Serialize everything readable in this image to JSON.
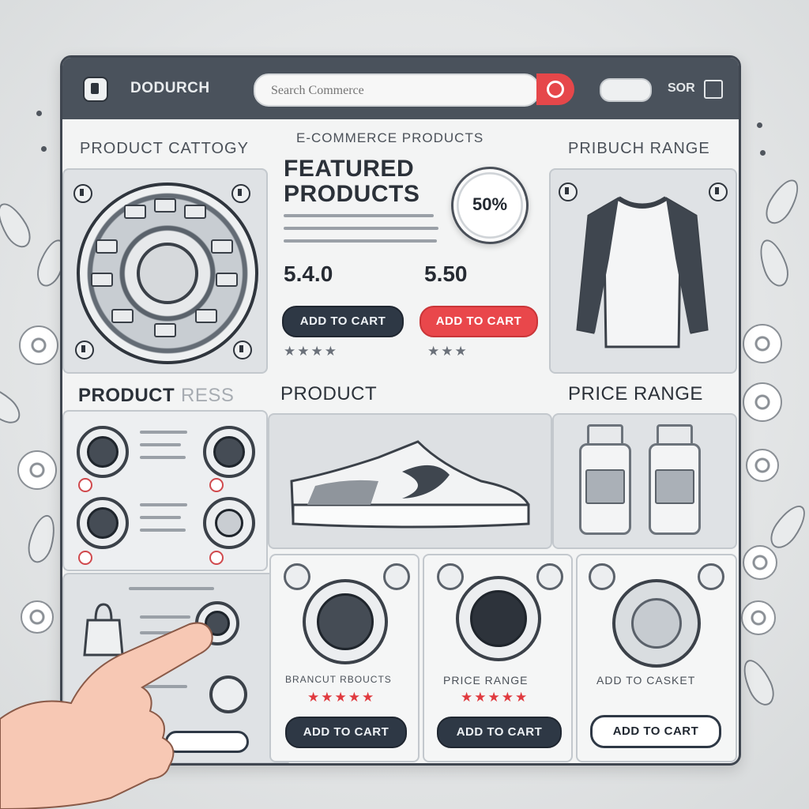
{
  "header": {
    "brand": "DODURCH",
    "search_placeholder": "Search Commerce",
    "nav_button_label": "",
    "nav_text": "SOR"
  },
  "sections": {
    "left_top_title": "PRODUCT CATTOGY",
    "center_top_subtitle": "E-COMMERCE   PRODUCTS",
    "right_top_title": "PRIBUCH RANGE",
    "featured_title_line1": "FEATURED",
    "featured_title_line2": "PRODUCTS",
    "left_mid_title": "PRODUCT",
    "left_mid_title_faded": "RESS",
    "center_mid_title": "PRODUCT",
    "right_mid_title": "PRICE RANGE"
  },
  "featured": {
    "discount_badge": "50%",
    "item1": {
      "price": "5.4.0",
      "add_to_cart": "ADD TO CART"
    },
    "item2": {
      "price": "5.50",
      "add_to_cart": "ADD TO CART"
    }
  },
  "bottom_cards": [
    {
      "title": "BRANCUT RBOUCTS",
      "add_to_cart": "ADD TO CART"
    },
    {
      "title": "PRICE RANGE",
      "add_to_cart": "ADD TO CART"
    },
    {
      "title": "ADD TO CASKET",
      "add_to_cart": "ADD TO CART"
    }
  ],
  "ratings": {
    "featured_item1_stars": "★★★★",
    "featured_item2_stars": "★★★",
    "card_stars": "★★★★★"
  },
  "colors": {
    "accent_red": "#e9474b",
    "dark_button": "#2e3845",
    "topbar": "#4a525c"
  },
  "icons": {
    "search": "search-icon",
    "shopping_bag": "shopping-bag-icon"
  }
}
